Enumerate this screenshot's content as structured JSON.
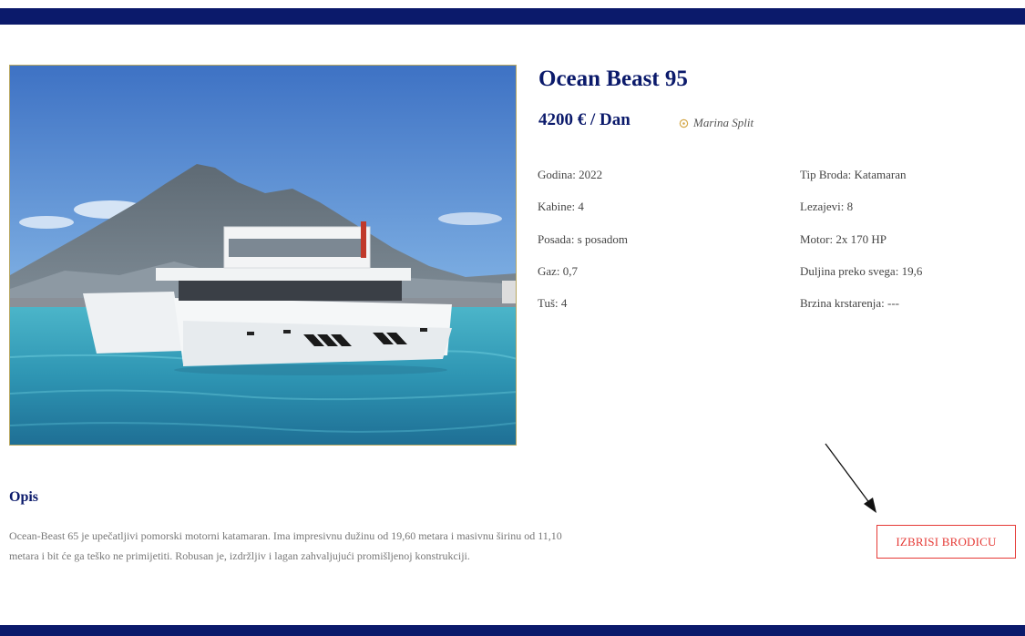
{
  "boat": {
    "name": "Ocean Beast 95",
    "price": "4200 € / Dan",
    "location": "Marina Split"
  },
  "specs_left": [
    {
      "label": "Godina:",
      "value": "2022"
    },
    {
      "label": "Kabine:",
      "value": "4"
    },
    {
      "label": "Posada:",
      "value": "s posadom"
    },
    {
      "label": "Gaz:",
      "value": "0,7"
    },
    {
      "label": "Tuš:",
      "value": "4"
    }
  ],
  "specs_right": [
    {
      "label": "Tip Broda:",
      "value": "Katamaran"
    },
    {
      "label": "Lezajevi:",
      "value": "8"
    },
    {
      "label": "Motor:",
      "value": "2x 170 HP"
    },
    {
      "label": "Duljina preko svega:",
      "value": "19,6"
    },
    {
      "label": "Brzina krstarenja:",
      "value": "---"
    }
  ],
  "description": {
    "title": "Opis",
    "line1": "Ocean-Beast 65 je upečatljivi pomorski motorni katamaran. Ima impresivnu dužinu od 19,60 metara i masivnu širinu od 11,10",
    "line2": "metara i bit će ga teško ne primijetiti. Robusan je, izdržljiv i lagan zahvaljujući promišljenoj konstrukciji."
  },
  "actions": {
    "delete_label": "IZBRISI BRODICU"
  },
  "colors": {
    "brand_navy": "#0b1a6b",
    "danger": "#e53935",
    "pin": "#d4a84a"
  },
  "icons": {
    "location": "map-pin-icon",
    "annotation": "arrow-icon"
  }
}
